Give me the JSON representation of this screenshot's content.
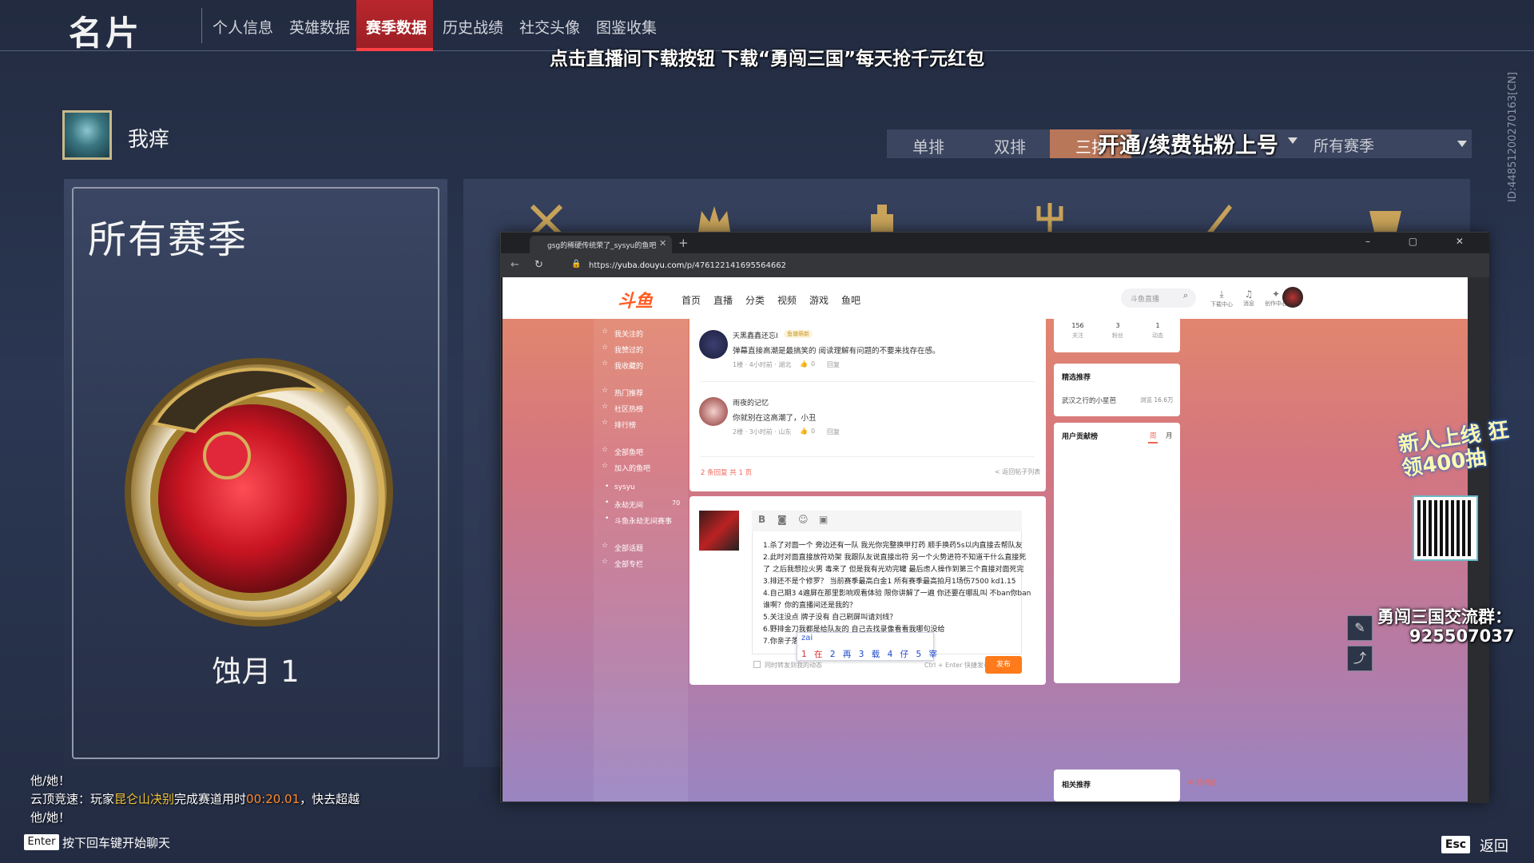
{
  "game": {
    "title": "名片",
    "nav": [
      "个人信息",
      "英雄数据",
      "赛季数据",
      "历史战绩",
      "社交头像",
      "图鉴收集"
    ],
    "active_nav": "赛季数据",
    "promo": "点击直播间下载按钮 下载“勇闯三国”每天抢千元红包",
    "player_name": "我痒",
    "modes": [
      "单排",
      "双排",
      "三排"
    ],
    "active_mode": "三排",
    "vip_overlay": "开通/续费钻粉上号",
    "season_select": "所有赛季",
    "card_title": "所有赛季",
    "badge_name": "蚀月 1",
    "accent": "#b8262c"
  },
  "browser": {
    "tab_title": "gsg的稀硬传统荣了_sysyu的鱼吧",
    "url_prefix": "https://",
    "url_host": "yuba.douyu.com",
    "url_path": "/p/476122141695564662",
    "site": {
      "logo": "斗鱼",
      "nav": [
        "首页",
        "直播",
        "分类",
        "视频",
        "游戏",
        "鱼吧"
      ],
      "search_placeholder": "斗鱼直播",
      "header_icons": [
        "下载中心",
        "消息",
        "创作中心"
      ],
      "left_menu": [
        "我关注的",
        "我赞过的",
        "我收藏的",
        "热门推荐",
        "社区热榜",
        "排行榜",
        "全部鱼吧",
        "加入的鱼吧",
        "sysyu",
        "永劫无间",
        "斗鱼永劫无间赛事",
        "全部话题",
        "全部专栏"
      ],
      "left_menu_count": "70",
      "comments": [
        {
          "user": "天黑鑫鑫还忘I",
          "tag": "鱼塘萌新",
          "text": "弹幕直接高潮是最搞笑的 阅读理解有问题的不要来找存在感。",
          "meta": "1楼 · 4小时前 · 湖北",
          "likes": "0",
          "reply": "回复"
        },
        {
          "user": "雨夜的记忆",
          "text": "你就别在这高潮了，小丑",
          "meta": "2楼 · 3小时前 · 山东",
          "likes": "0",
          "reply": "回复"
        }
      ],
      "pager": "2 条回复 共 1 页",
      "back_to_list": "< 返回帖子列表",
      "editor_lines": [
        "1.杀了对面一个 旁边还有一队 我光你完整换甲打药 顺手换药5s以内直接去帮队友",
        "2.此时对面直接放符劝架 我跟队友说直接出符 另一个火势进符不知道干什么直接死",
        "了 之后我想拉火男 毒来了 但是我有光劝完罐 最后虑人操作到第三个直接对面死完",
        "3.排还不是个修罗？ 当前赛季最高白金1 所有赛季最高拍月1场伤7500 kd1.15",
        "4.自己期3 4遍屏在那里影响观看体验 限你讲解了一遍 你还要在哪乱叫 不ban你ban",
        "谁啊？你的直播间还是我的？",
        "5.关注没点 牌子没有 自己刷屏叫请刘线？",
        "6.野排金刀我都是给队友的 自己去找录像看看我哪句没给",
        "7.你亲子落zai"
      ],
      "ime_input": "zai",
      "ime_candidates": [
        "1 在",
        "2 再",
        "3 载",
        "4 仔",
        "5 宰"
      ],
      "sync_label": "同时转发到我的动态",
      "send_hint": "Ctrl + Enter 快捷发布",
      "send_label": "发布",
      "user_stats": [
        {
          "n": "156",
          "l": "关注"
        },
        {
          "n": "3",
          "l": "粉丝"
        },
        {
          "n": "1",
          "l": "动态"
        }
      ],
      "featured_title": "精选推荐",
      "featured_item": "武汉之行的小星芭",
      "featured_views": "浏览 16.6万",
      "contrib_title": "用户贡献榜",
      "contrib_tabs": [
        "周",
        "月"
      ],
      "related_title": "相关推荐",
      "mail_label": "站内信"
    }
  },
  "overlay": {
    "new_event": "新人上线 狂领400抽",
    "group_name": "勇闯三国交流群：",
    "group_number": "925507037",
    "room_id": "ID:4485120027016​3[CN]"
  },
  "chat": {
    "lines": [
      {
        "text": "他/她！"
      },
      {
        "prefix": "云顶竞速：玩家",
        "player": "昆仑山决别",
        "mid": "完成赛道用时",
        "time": "00:20.01",
        "suffix": "，快去超越"
      },
      {
        "text": "他/她！"
      }
    ],
    "enter_key": "Enter",
    "enter_hint": "按下回车键开始聊天",
    "esc_key": "Esc",
    "esc_label": "返回"
  }
}
